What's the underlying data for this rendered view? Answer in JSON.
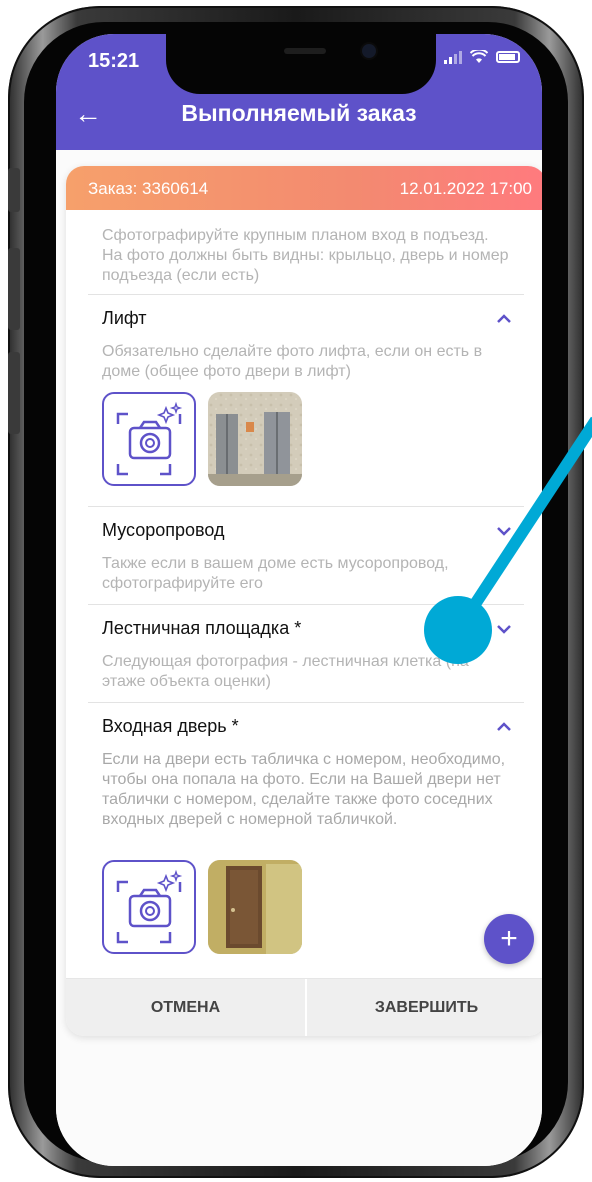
{
  "status_bar": {
    "time": "15:21"
  },
  "app_bar": {
    "back_icon": "arrow-left-icon",
    "title": "Выполняемый заказ"
  },
  "order": {
    "number": "Заказ: 3360614",
    "datetime": "12.01.2022 17:00"
  },
  "sections": [
    {
      "title": "",
      "description": "Сфотографируйте крупным планом вход в подъезд. На фото должны быть видны: крыльцо, дверь и номер подъезда (если есть)"
    },
    {
      "title": "Лифт",
      "description": "Обязательно сделайте фото лифта, если он есть в доме (общее фото двери в лифт)",
      "expanded": true
    },
    {
      "title": "Мусоропровод",
      "description": "Также если в вашем доме есть мусоропровод, сфотографируйте его",
      "expanded": false
    },
    {
      "title": "Лестничная площадка *",
      "description": "Следующая фотография - лестничная клетка (на этаже объекта оценки)",
      "expanded": false
    },
    {
      "title": "Входная дверь *",
      "description": "Если на двери есть табличка с номером, необходимо, чтобы она попала на фото. Если на Вашей двери нет таблички с номером, сделайте также фото соседних входных дверей с номерной табличкой.",
      "expanded": true
    }
  ],
  "fab": {
    "label": "+"
  },
  "footer": {
    "cancel": "ОТМЕНА",
    "finish": "ЗАВЕРШИТЬ"
  },
  "colors": {
    "accent": "#5e52c9",
    "header_gradient_start": "#f6a06b",
    "header_gradient_end": "#ff7a7e",
    "pointer": "#00a9d6"
  }
}
